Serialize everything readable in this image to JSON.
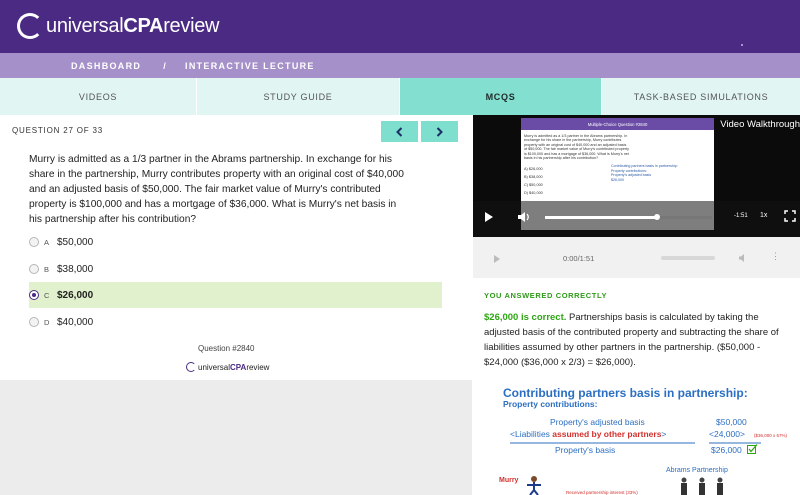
{
  "header": {
    "logo_text_1": "universal",
    "logo_text_2": "CPA",
    "logo_text_3": "review"
  },
  "breadcrumb": {
    "item1": "DASHBOARD",
    "separator": "/",
    "item2": "INTERACTIVE LECTURE"
  },
  "tabs": [
    {
      "label": "VIDEOS",
      "active": false
    },
    {
      "label": "STUDY GUIDE",
      "active": false
    },
    {
      "label": "MCQS",
      "active": true
    },
    {
      "label": "TASK-BASED SIMULATIONS",
      "active": false
    }
  ],
  "question": {
    "counter": "QUESTION 27 OF 33",
    "text": "Murry is admitted as a 1/3 partner in the Abrams partnership. In exchange for his share in the partnership, Murry contributes property with an original cost of $40,000 and an adjusted basis of $50,000. The fair market value of Murry's contributed property is $100,000 and has a mortgage of $36,000. What is Murry's net basis in his partnership after his contribution?",
    "options": [
      {
        "letter": "A",
        "value": "$50,000",
        "selected": false
      },
      {
        "letter": "B",
        "value": "$38,000",
        "selected": false
      },
      {
        "letter": "C",
        "value": "$26,000",
        "selected": true
      },
      {
        "letter": "D",
        "value": "$40,000",
        "selected": false
      }
    ],
    "id_label": "Question #2840",
    "footer_logo_1": "universal",
    "footer_logo_2": "CPA",
    "footer_logo_3": "review"
  },
  "video": {
    "title": "Video Walkthrough",
    "time": "-1:51",
    "speed": "1x",
    "progress_fraction": 0.67,
    "slide": {
      "header": "Multiple-Choice Question #2840",
      "text": "Murry is admitted as a 1/3 partner in the Abrams partnership. In exchange for his share in the partnership, Murry contributes property with an original cost of $40,000 and an adjusted basis of $50,000. The fair market value of Murry's contributed property is $100,000 and has a mortgage of $36,000. What is Murry's net basis in his partnership after his contribution?",
      "answers": [
        "A) $26,000",
        "B) $38,000",
        "C) $50,000",
        "D) $40,000"
      ]
    }
  },
  "audio": {
    "time": "0:00/1:51"
  },
  "feedback": {
    "status": "YOU ANSWERED CORRECTLY",
    "lead": "$26,000 is correct.",
    "body": " Partnerships basis is calculated by taking the adjusted basis of the contributed property and subtracting the share of liabilities assumed by other partners in the partnership. ($50,000 - $24,000 ($36,000 x 2/3) = $26,000)."
  },
  "diagram": {
    "title": "Contributing partners basis in partnership:",
    "subtitle": "Property contributions:",
    "line1": "Property's adjusted basis",
    "line2_a": "<Liabilities ",
    "line2_b": "assumed by other partners",
    "line2_c": ">",
    "line3": "Property's basis",
    "num1": "$50,000",
    "num2": "<24,000>",
    "num3": "$26,000",
    "note": "($36,000 x 67%)",
    "murry": "Murry",
    "abrams": "Abrams Partnership",
    "received": "Received partnership interest (33%)"
  }
}
